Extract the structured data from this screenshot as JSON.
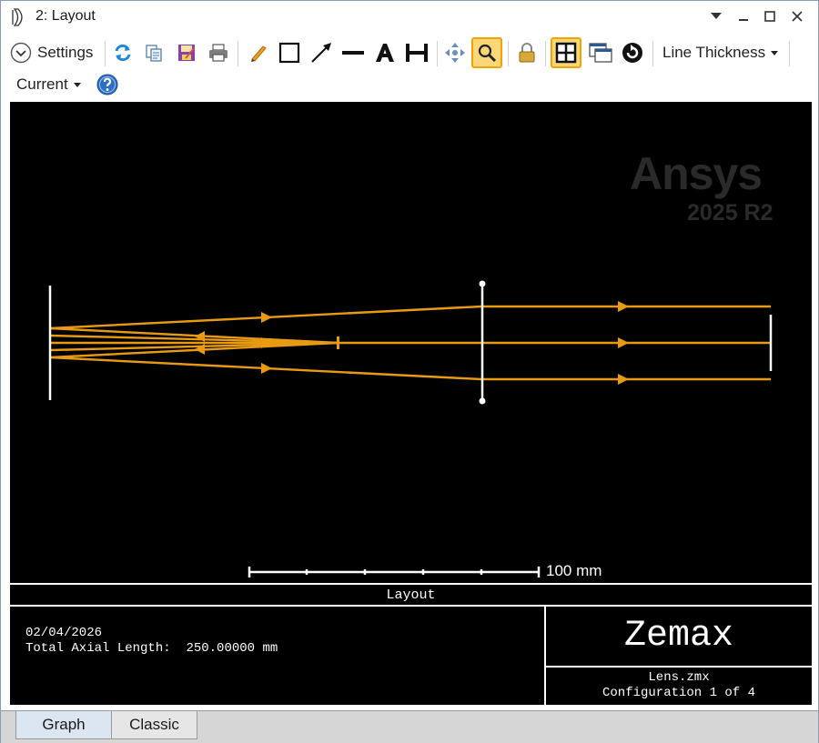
{
  "window": {
    "title": "2: Layout",
    "controls": [
      "dropdown",
      "minimize",
      "maximize",
      "close"
    ]
  },
  "toolbar": {
    "settings_label": "Settings",
    "line_thickness_label": "Line Thickness",
    "current_label": "Current",
    "icons": [
      "refresh-icon",
      "copy-icon",
      "save-icon",
      "print-icon",
      "pencil-icon",
      "rectangle-icon",
      "arrow-icon",
      "line-icon",
      "text-icon",
      "dimension-icon",
      "pan-icon",
      "zoom-icon",
      "lock-icon",
      "crosshair-icon",
      "windows-icon",
      "rotate-icon",
      "help-icon"
    ],
    "active_tools": [
      "zoom-icon",
      "crosshair-icon"
    ]
  },
  "graph": {
    "watermark_brand": "Ansys",
    "watermark_version": "2025 R2",
    "scale_bar_label": "100 mm",
    "ray_color": "#e89b12",
    "lens_color": "#ffffff"
  },
  "footer": {
    "title": "Layout",
    "date": "02/04/2026",
    "axial_length_label": "Total Axial Length:",
    "axial_length_value": "250.00000 mm",
    "brand": "Zemax",
    "file_name": "Lens.zmx",
    "configuration": "Configuration 1 of 4"
  },
  "tabs": [
    {
      "label": "Graph",
      "active": true
    },
    {
      "label": "Classic",
      "active": false
    }
  ]
}
